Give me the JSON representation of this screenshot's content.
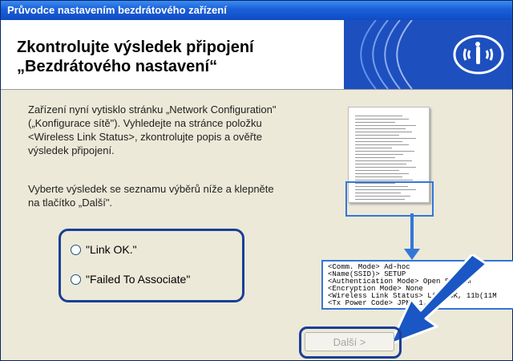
{
  "window": {
    "title": "Průvodce nastavením bezdrátového zařízení"
  },
  "header": {
    "title_line1": "Zkontrolujte výsledek připojení",
    "title_line2": "„Bezdrátového nastavení“"
  },
  "body": {
    "paragraph1_line1": "Zařízení nyní vytisklo stránku „Network Configuration\"",
    "paragraph1_line2": "(„Konfigurace sítě\"). Vyhledejte na stránce položku",
    "paragraph1_line3": "<Wireless Link Status>, zkontrolujte popis a ověřte",
    "paragraph1_line4": "výsledek připojení.",
    "paragraph2_line1": "Vyberte výsledek se seznamu výběrů níže a klepněte",
    "paragraph2_line2": "na tlačítko „Další\"."
  },
  "options": [
    {
      "label": "\"Link OK.\""
    },
    {
      "label": "\"Failed To Associate\""
    }
  ],
  "zoom_lines": [
    "<Comm. Mode>                Ad-hoc",
    "<Name(SSID)>                SETUP",
    "<Authentication Mode>      Open System",
    "<Encryption Mode>          None",
    "<Wireless Link Status>     Link OK, 11b(11M",
    "<Tx Power Code>            JPN, 1, 0"
  ],
  "buttons": {
    "next": "Další >"
  },
  "colors": {
    "accent": "#1a3f96",
    "titlebar": "#1a5fd8",
    "arrow": "#1a56c4"
  },
  "icons": {
    "logo": "wireless-signal-icon",
    "arrow": "big-arrow-icon"
  }
}
